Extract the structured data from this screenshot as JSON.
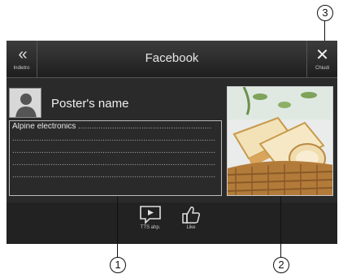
{
  "header": {
    "title": "Facebook",
    "back_label": "Indietro",
    "back_glyph": "«",
    "close_label": "Chiudi",
    "close_glyph": "✕"
  },
  "post": {
    "poster_name": "Poster's name",
    "message_lines": [
      "Alpine electronics",
      "",
      "",
      "",
      ""
    ],
    "photo": "bread-basket-image"
  },
  "toolbar": {
    "tts_label": "TTS ahp.",
    "like_label": "Like"
  },
  "callouts": {
    "one": "1",
    "two": "2",
    "three": "3"
  },
  "icons": {
    "back": "double-chevron-left-icon",
    "close": "close-icon",
    "avatar": "person-silhouette-icon",
    "tts": "speech-bubble-play-icon",
    "like": "thumbs-up-icon"
  }
}
